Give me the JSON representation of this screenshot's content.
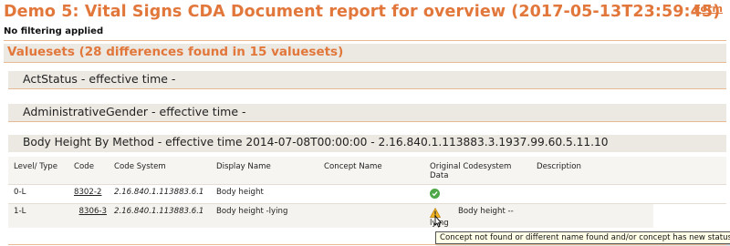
{
  "page": {
    "title": "Demo 5: Vital Signs CDA Document report for overview (2017-05-13T23:59:45)",
    "form_link": "Form",
    "filter_note": "No filtering applied"
  },
  "section": {
    "title": "Valuesets (28 differences found in 15 valuesets)"
  },
  "valuesets": [
    {
      "title": "ActStatus - effective time -"
    },
    {
      "title": "AdministrativeGender - effective time -"
    },
    {
      "title": "Body Height By Method - effective time 2014-07-08T00:00:00 - 2.16.840.1.113883.3.1937.99.60.5.11.10"
    }
  ],
  "table": {
    "columns": [
      "Level/ Type",
      "Code",
      "Code System",
      "Display Name",
      "Concept Name",
      "Original Codesystem Data",
      "Description"
    ],
    "rows": [
      {
        "level": "0-L",
        "code": "8302-2",
        "code_system": "2.16.840.1.113883.6.1",
        "display_name": "Body height",
        "concept_name": "",
        "status_icon": "check-circle-icon",
        "description": ""
      },
      {
        "level": "1-L",
        "code": "8306-3",
        "code_system": "2.16.840.1.113883.6.1",
        "display_name": "Body height -lying",
        "concept_name": "",
        "status_icon": "warning-icon",
        "status_text": "lying",
        "description": "Body height --"
      }
    ]
  },
  "tooltip": {
    "text": "Concept not found or different name found and/or concept has new status"
  },
  "colors": {
    "accent": "#e2773b",
    "header_bg": "#ece8e2",
    "ok": "#4ea84a",
    "warn": "#f0b323"
  }
}
